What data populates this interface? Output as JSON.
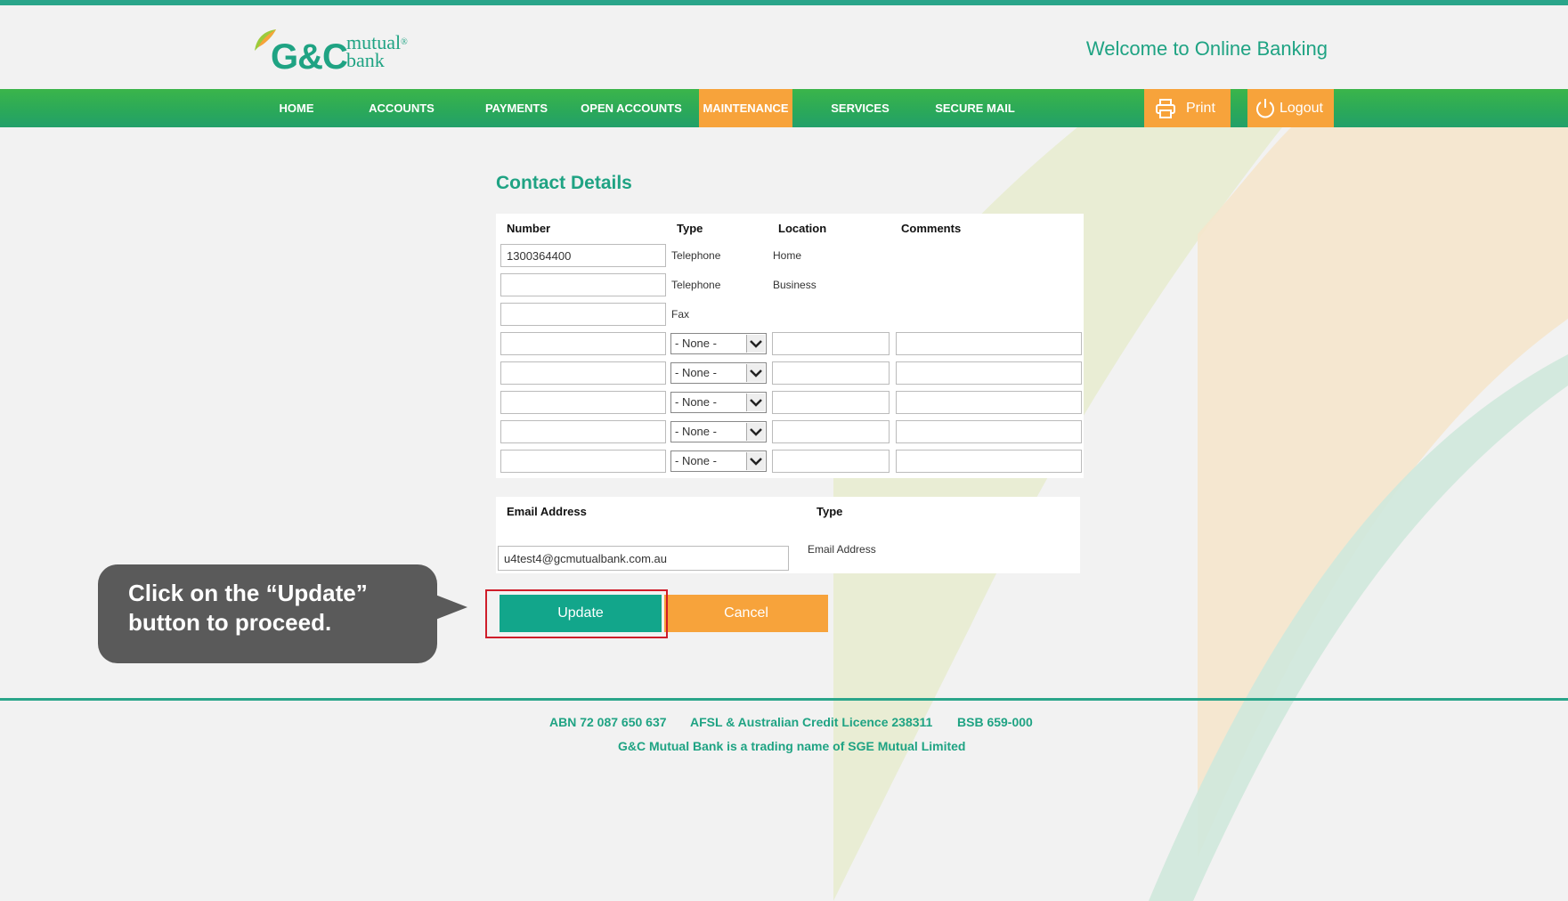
{
  "header": {
    "logo_text": "G&C",
    "logo_mutual": "mutual",
    "logo_bank": "bank",
    "logo_reg": "®",
    "welcome": "Welcome to Online Banking"
  },
  "nav": {
    "items": [
      "HOME",
      "ACCOUNTS",
      "PAYMENTS",
      "OPEN ACCOUNTS",
      "MAINTENANCE",
      "SERVICES",
      "SECURE MAIL"
    ],
    "active": "MAINTENANCE",
    "print_label": "Print",
    "logout_label": "Logout"
  },
  "page": {
    "title": "Contact Details"
  },
  "contacts": {
    "headers": {
      "number": "Number",
      "type": "Type",
      "location": "Location",
      "comments": "Comments"
    },
    "fixed_rows": [
      {
        "number": "1300364400",
        "type": "Telephone",
        "location": "Home"
      },
      {
        "number": "",
        "type": "Telephone",
        "location": "Business"
      },
      {
        "number": "",
        "type": "Fax",
        "location": ""
      }
    ],
    "editable_rows": [
      {
        "number": "",
        "type": "- None -",
        "location": "",
        "comments": ""
      },
      {
        "number": "",
        "type": "- None -",
        "location": "",
        "comments": ""
      },
      {
        "number": "",
        "type": "- None -",
        "location": "",
        "comments": ""
      },
      {
        "number": "",
        "type": "- None -",
        "location": "",
        "comments": ""
      },
      {
        "number": "",
        "type": "- None -",
        "location": "",
        "comments": ""
      }
    ]
  },
  "email": {
    "header_address": "Email Address",
    "header_type": "Type",
    "value": "u4test4@gcmutualbank.com.au",
    "type": "Email Address"
  },
  "actions": {
    "update": "Update",
    "cancel": "Cancel"
  },
  "callout": {
    "line1": "Click on the “Update”",
    "line2": "button to proceed."
  },
  "footer": {
    "abn": "ABN 72 087 650 637",
    "afsl": "AFSL & Australian Credit Licence 238311",
    "bsb": "BSB 659-000",
    "trading": "G&C Mutual Bank is a trading name of SGE Mutual Limited"
  },
  "colors": {
    "brand_green": "#1fa383",
    "accent_orange": "#f7a33b",
    "callout_gray": "#5a5a5a",
    "highlight_red": "#cf1d2a"
  }
}
